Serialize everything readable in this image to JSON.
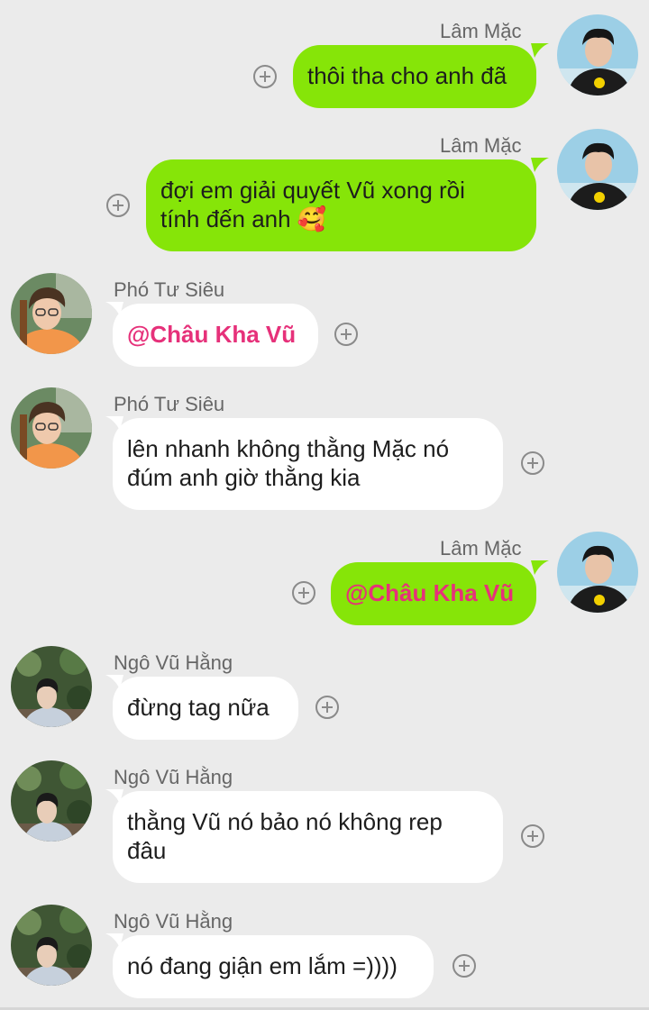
{
  "chat": {
    "messages": [
      {
        "sender": "Lâm Mặc",
        "direction": "out",
        "text": "thôi tha cho anh đã"
      },
      {
        "sender": "Lâm Mặc",
        "direction": "out",
        "text_lines": [
          "đợi em giải quyết Vũ xong rồi",
          "tính đến anh"
        ],
        "emoji": "🥰"
      },
      {
        "sender": "Phó Tư Siêu",
        "direction": "in",
        "mention": "@Châu Kha Vũ"
      },
      {
        "sender": "Phó Tư Siêu",
        "direction": "in",
        "text_lines": [
          "lên nhanh không thằng Mặc nó",
          "đúm anh giờ thằng kia"
        ]
      },
      {
        "sender": "Lâm Mặc",
        "direction": "out",
        "mention": "@Châu Kha Vũ"
      },
      {
        "sender": "Ngô Vũ Hằng",
        "direction": "in",
        "text": "đừng tag nữa"
      },
      {
        "sender": "Ngô Vũ Hằng",
        "direction": "in",
        "text_lines": [
          "thằng Vũ nó bảo nó không rep",
          "đâu"
        ]
      },
      {
        "sender": "Ngô Vũ Hằng",
        "direction": "in",
        "text": "nó đang giận em lắm =))))"
      }
    ]
  },
  "colors": {
    "background": "#ebebeb",
    "outgoing_bubble": "#86e508",
    "incoming_bubble": "#ffffff",
    "mention": "#e6317a",
    "sender_name": "#666666"
  },
  "icons": {
    "react": "add-reaction-icon"
  }
}
